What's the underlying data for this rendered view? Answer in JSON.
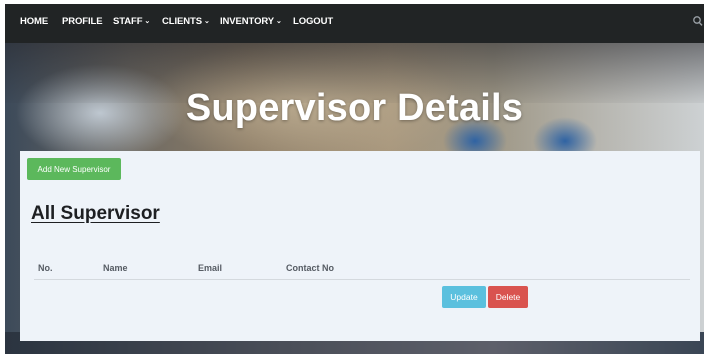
{
  "navbar": {
    "items": [
      {
        "label": "HOME",
        "dropdown": false
      },
      {
        "label": "PROFILE",
        "dropdown": false
      },
      {
        "label": "STAFF",
        "dropdown": true
      },
      {
        "label": "CLIENTS",
        "dropdown": true
      },
      {
        "label": "INVENTORY",
        "dropdown": true
      },
      {
        "label": "LOGOUT",
        "dropdown": false
      }
    ],
    "search_icon": "search-icon",
    "caret_icon": "chevron-down-icon"
  },
  "hero": {
    "title": "Supervisor Details"
  },
  "card": {
    "add_button_label": "Add New Supervisor",
    "section_title": "All Supervisor",
    "table": {
      "columns": [
        "No.",
        "Name",
        "Email",
        "Contact No"
      ]
    },
    "update_label": "Update",
    "delete_label": "Delete"
  },
  "colors": {
    "navbar_bg": "#212425",
    "card_bg": "#eef3f9",
    "success": "#5cb85c",
    "info": "#5bc0de",
    "danger": "#d9534f"
  }
}
